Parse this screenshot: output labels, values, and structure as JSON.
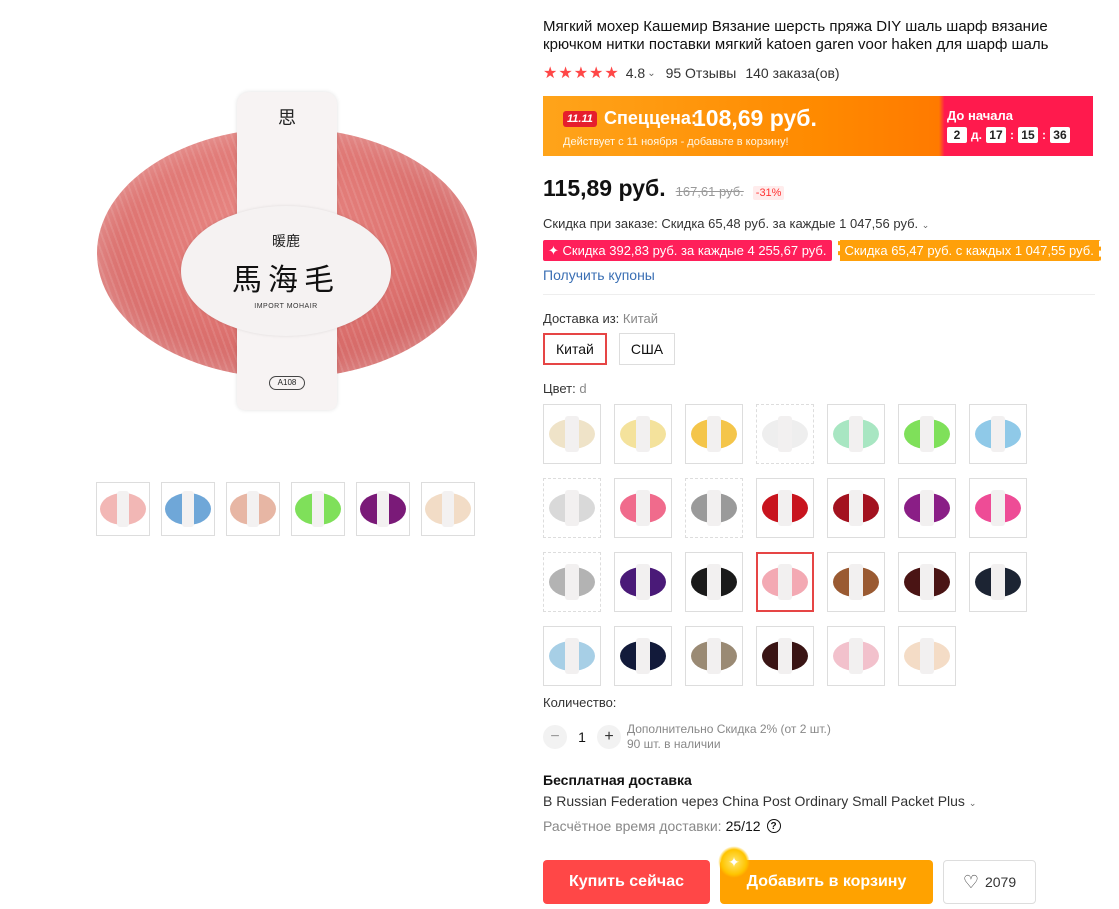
{
  "product": {
    "title": "Мягкий мохер Кашемир Вязание шерсть пряжа DIY шаль шарф вязание крючком нитки поставки мягкий katoen garen voor haken для шарф шаль",
    "rating": "4.8",
    "reviews": "95 Отзывы",
    "orders": "140 заказа(ов)"
  },
  "image_label": {
    "emblem": "思",
    "brand": "暖鹿",
    "main": "馬海毛",
    "sub": "IMPORT MOHAIR",
    "code": "A108"
  },
  "promo": {
    "tag": "11.11",
    "label": "Спеццена:",
    "price": "108,69 руб.",
    "note": "Действует с 11 ноября - добавьте в корзину!",
    "until_label": "До начала",
    "days": "2",
    "days_unit": "д.",
    "hours": "17",
    "minutes": "15",
    "seconds": "36"
  },
  "pricing": {
    "price": "115,89 руб.",
    "old_price": "167,61 руб.",
    "discount": "-31%",
    "order_discount": "Скидка при заказе: Скидка 65,48 руб. за каждые 1 047,56 руб.",
    "coupon_1": "✦ Скидка 392,83 руб. за каждые 4 255,67 руб.",
    "coupon_2": "Скидка 65,47 руб. с каждых 1 047,55 руб.",
    "get_coupons": "Получить купоны"
  },
  "shipping_from": {
    "label": "Доставка из:",
    "value": "Китай",
    "options": [
      "Китай",
      "США"
    ]
  },
  "color": {
    "label": "Цвет:",
    "value": "d",
    "swatches": [
      {
        "color": "#efe3c8"
      },
      {
        "color": "#f4e29c"
      },
      {
        "color": "#f4c54a"
      },
      {
        "color": "#eeeeee"
      },
      {
        "color": "#a8e6c2"
      },
      {
        "color": "#7fe05a"
      },
      {
        "color": "#8fc9e8"
      },
      {
        "color": "#d9d9d9"
      },
      {
        "color": "#f06b8c"
      },
      {
        "color": "#9a9a9a"
      },
      {
        "color": "#c8141e"
      },
      {
        "color": "#a3121f"
      },
      {
        "color": "#8a1e86"
      },
      {
        "color": "#ee4c96"
      },
      {
        "color": "#b3b3b3"
      },
      {
        "color": "#4a1a78"
      },
      {
        "color": "#1a1a1a"
      },
      {
        "color": "#f3a9b3"
      },
      {
        "color": "#9a5a32"
      },
      {
        "color": "#4a1414"
      },
      {
        "color": "#1c2433"
      },
      {
        "color": "#a7cfe6"
      },
      {
        "color": "#121a3a"
      },
      {
        "color": "#9a8a74"
      },
      {
        "color": "#3a1515"
      },
      {
        "color": "#f2c1cc"
      },
      {
        "color": "#f4dcc6"
      }
    ]
  },
  "thumbnails": [
    {
      "color": "#f2b7b5"
    },
    {
      "color": "#6fa7d8"
    },
    {
      "color": "#e7b6a4"
    },
    {
      "color": "#7fe05a"
    },
    {
      "color": "#7a1a78"
    },
    {
      "color": "#f2dcc6"
    }
  ],
  "quantity": {
    "label": "Количество:",
    "value": "1",
    "minus": "−",
    "plus": "+",
    "extra_discount": "Дополнительно Скидка 2% (от 2 шт.)",
    "stock": "90 шт. в наличии"
  },
  "delivery": {
    "free": "Бесплатная доставка",
    "method": "В Russian Federation через China Post Ordinary Small Packet Plus",
    "time_label": "Расчётное время доставки:",
    "time_value": "25/12"
  },
  "actions": {
    "buy_now": "Купить сейчас",
    "add_to_cart": "Добавить в корзину",
    "wishlist_count": "2079"
  }
}
